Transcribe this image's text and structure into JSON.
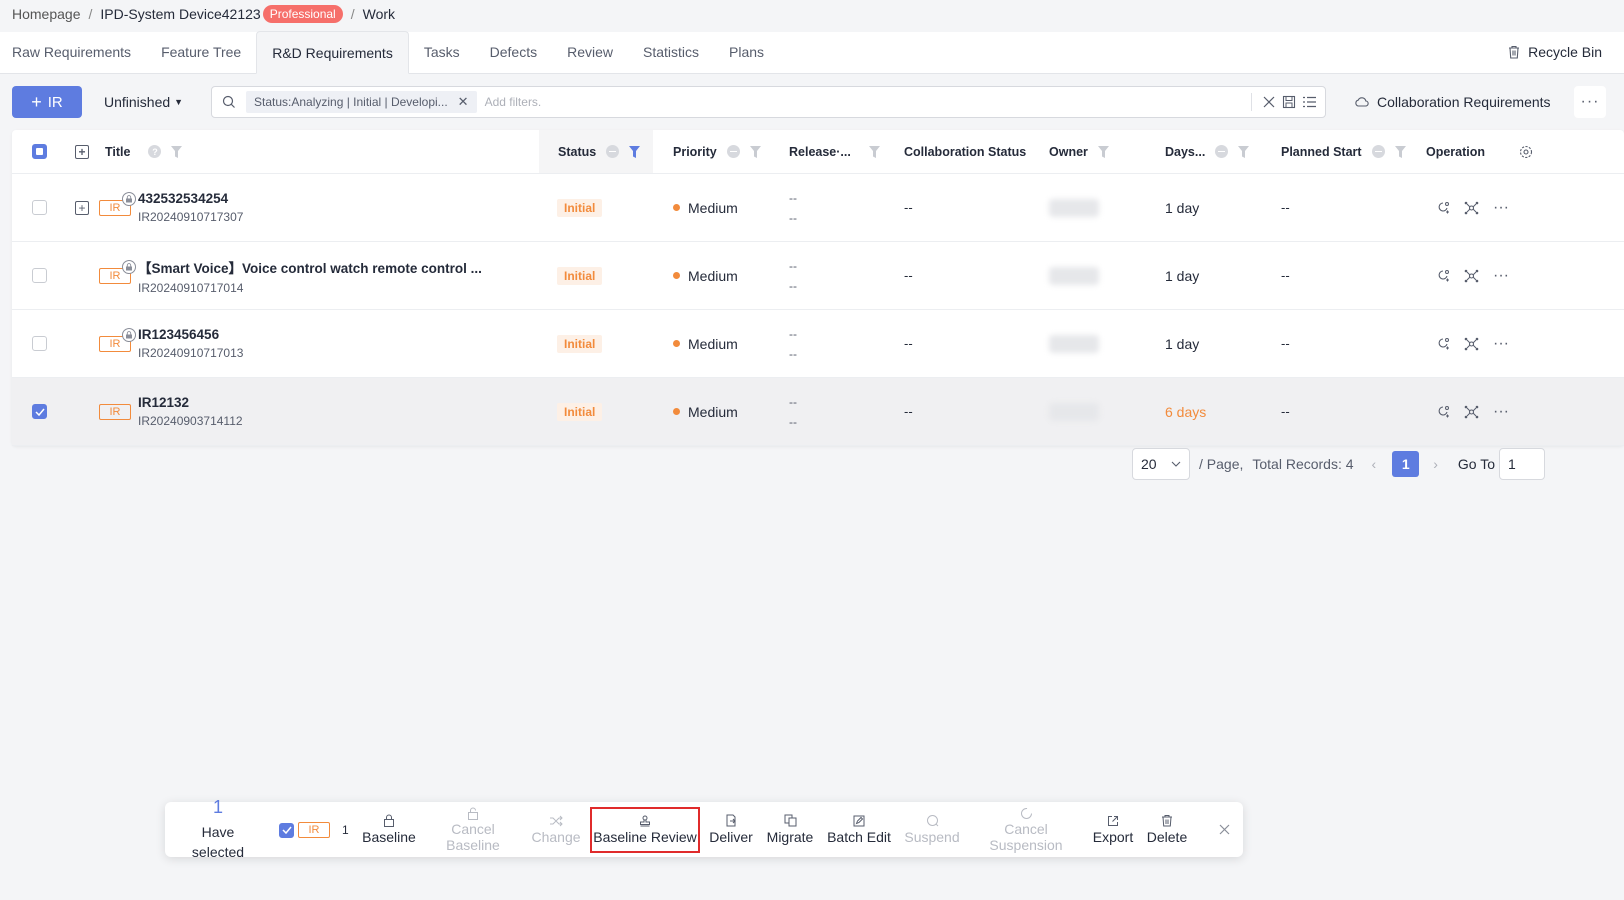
{
  "breadcrumb": {
    "home": "Homepage",
    "project": "IPD-System Device42123",
    "edition_badge": "Professional",
    "current": "Work"
  },
  "tabs": [
    "Raw Requirements",
    "Feature Tree",
    "R&D Requirements",
    "Tasks",
    "Defects",
    "Review",
    "Statistics",
    "Plans"
  ],
  "active_tab": "R&D Requirements",
  "recycle_bin": "Recycle Bin",
  "toolbar": {
    "create_button": "IR",
    "view_selector": "Unfinished",
    "filter_chip": "Status:Analyzing | Initial | Developi...",
    "filter_placeholder": "Add filters.",
    "collaboration": "Collaboration Requirements"
  },
  "table": {
    "headers": {
      "title": "Title",
      "status": "Status",
      "priority": "Priority",
      "release": "Release·...",
      "collab_status": "Collaboration Status",
      "owner": "Owner",
      "days": "Days...",
      "planned_start": "Planned Start",
      "operation": "Operation"
    },
    "rows": [
      {
        "tag": "IR",
        "title": "432532534254",
        "id": "IR20240910717307",
        "status": "Initial",
        "priority": "Medium",
        "release_1": "--",
        "release_2": "--",
        "collab": "--",
        "days": "1 day",
        "planned_start": "--"
      },
      {
        "tag": "IR",
        "title": "【Smart Voice】Voice control watch remote control ...",
        "id": "IR20240910717014",
        "status": "Initial",
        "priority": "Medium",
        "release_1": "--",
        "release_2": "--",
        "collab": "--",
        "days": "1 day",
        "planned_start": "--"
      },
      {
        "tag": "IR",
        "title": "IR123456456",
        "id": "IR20240910717013",
        "status": "Initial",
        "priority": "Medium",
        "release_1": "--",
        "release_2": "--",
        "collab": "--",
        "days": "1 day",
        "planned_start": "--"
      },
      {
        "tag": "IR",
        "title": "IR12132",
        "id": "IR20240903714112",
        "status": "Initial",
        "priority": "Medium",
        "release_1": "--",
        "release_2": "--",
        "collab": "--",
        "days": "6 days",
        "planned_start": "--"
      }
    ]
  },
  "pagination": {
    "page_size": "20",
    "per_page": "/ Page,",
    "total": "Total Records: 4",
    "current_page": "1",
    "goto_label": "Go To",
    "goto_value": "1"
  },
  "batch_bar": {
    "selected_count": "1",
    "have_selected_1": "Have",
    "have_selected_2": "selected",
    "type_tag": "IR",
    "type_count": "1",
    "baseline": "Baseline",
    "cancel_baseline_1": "Cancel",
    "cancel_baseline_2": "Baseline",
    "change": "Change",
    "baseline_review": "Baseline Review",
    "deliver": "Deliver",
    "migrate": "Migrate",
    "batch_edit": "Batch Edit",
    "suspend": "Suspend",
    "cancel_suspension_1": "Cancel",
    "cancel_suspension_2": "Suspension",
    "export": "Export",
    "delete": "Delete"
  },
  "colors": {
    "primary": "#5e7ce0",
    "warning": "#f28b3c",
    "badge": "#f66f6a",
    "highlight": "#e02b2b"
  },
  "icons": [
    "search-icon",
    "close-icon",
    "save-icon",
    "list-icon",
    "trash-icon",
    "more-icon",
    "settings-icon",
    "filter-icon",
    "lock-icon",
    "link-icon",
    "graph-icon",
    "chevron-down-icon"
  ]
}
